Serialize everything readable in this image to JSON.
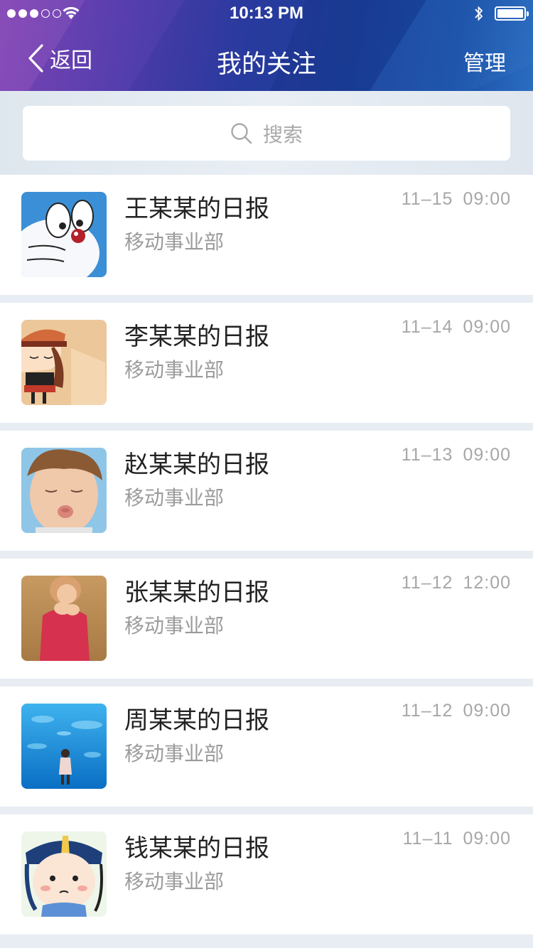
{
  "status_bar": {
    "time": "10:13 PM",
    "signal_bars": 3,
    "signal_total": 5
  },
  "nav": {
    "back_label": "返回",
    "title": "我的关注",
    "manage_label": "管理"
  },
  "search": {
    "placeholder": "搜索"
  },
  "items": [
    {
      "title": "王某某的日报",
      "dept": "移动事业部",
      "date": "11–15",
      "time": "09:00",
      "avatar": "doraemon-avatar"
    },
    {
      "title": "李某某的日报",
      "dept": "移动事业部",
      "date": "11–14",
      "time": "09:00",
      "avatar": "cartoon-girl-avatar"
    },
    {
      "title": "赵某某的日报",
      "dept": "移动事业部",
      "date": "11–13",
      "time": "09:00",
      "avatar": "child-pout-avatar"
    },
    {
      "title": "张某某的日报",
      "dept": "移动事业部",
      "date": "11–12",
      "time": "12:00",
      "avatar": "girl-pink-avatar"
    },
    {
      "title": "周某某的日报",
      "dept": "移动事业部",
      "date": "11–12",
      "time": "09:00",
      "avatar": "aquarium-avatar"
    },
    {
      "title": "钱某某的日报",
      "dept": "移动事业部",
      "date": "11–11",
      "time": "09:00",
      "avatar": "cartoon-boy-avatar"
    }
  ],
  "colors": {
    "header_start": "#7a3fb0",
    "header_end": "#2b6dc0",
    "title_text": "#222222",
    "secondary_text": "#9b9b9b",
    "time_text": "#a7a7a7"
  }
}
